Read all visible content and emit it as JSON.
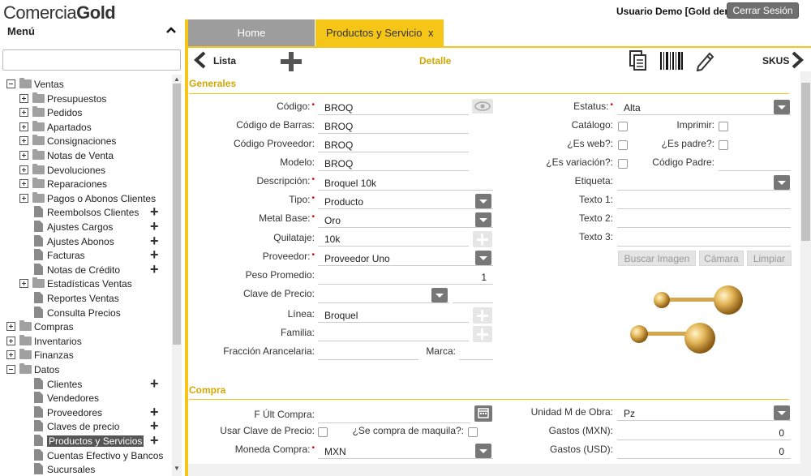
{
  "header": {
    "logo_text_1": "Comercia",
    "logo_text_2": "Gold",
    "user": "Usuario Demo [Gold demo]",
    "logout_label": "Cerrar Sesión"
  },
  "sidebar": {
    "title": "Menú",
    "search_placeholder": "",
    "items": [
      {
        "label": "Ventas",
        "level": 0,
        "kind": "folder-open"
      },
      {
        "label": "Presupuestos",
        "level": 1,
        "kind": "folder"
      },
      {
        "label": "Pedidos",
        "level": 1,
        "kind": "folder"
      },
      {
        "label": "Apartados",
        "level": 1,
        "kind": "folder"
      },
      {
        "label": "Consignaciones",
        "level": 1,
        "kind": "folder"
      },
      {
        "label": "Notas de Venta",
        "level": 1,
        "kind": "folder"
      },
      {
        "label": "Devoluciones",
        "level": 1,
        "kind": "folder"
      },
      {
        "label": "Reparaciones",
        "level": 1,
        "kind": "folder"
      },
      {
        "label": "Pagos o Abonos Clientes",
        "level": 1,
        "kind": "folder"
      },
      {
        "label": "Reembolsos Clientes",
        "level": 1,
        "kind": "doc",
        "add": true
      },
      {
        "label": "Ajustes Cargos",
        "level": 1,
        "kind": "doc",
        "add": true
      },
      {
        "label": "Ajustes Abonos",
        "level": 1,
        "kind": "doc",
        "add": true
      },
      {
        "label": "Facturas",
        "level": 1,
        "kind": "doc",
        "add": true
      },
      {
        "label": "Notas de Crédito",
        "level": 1,
        "kind": "doc",
        "add": true
      },
      {
        "label": "Estadísticas Ventas",
        "level": 1,
        "kind": "folder"
      },
      {
        "label": "Reportes Ventas",
        "level": 1,
        "kind": "doc"
      },
      {
        "label": "Consulta Precios",
        "level": 1,
        "kind": "doc"
      },
      {
        "label": "Compras",
        "level": 0,
        "kind": "folder"
      },
      {
        "label": "Inventarios",
        "level": 0,
        "kind": "folder"
      },
      {
        "label": "Finanzas",
        "level": 0,
        "kind": "folder"
      },
      {
        "label": "Datos",
        "level": 0,
        "kind": "folder-open"
      },
      {
        "label": "Clientes",
        "level": 1,
        "kind": "doc",
        "add": true
      },
      {
        "label": "Vendedores",
        "level": 1,
        "kind": "doc"
      },
      {
        "label": "Proveedores",
        "level": 1,
        "kind": "doc",
        "add": true
      },
      {
        "label": "Claves de precio",
        "level": 1,
        "kind": "doc",
        "add": true
      },
      {
        "label": "Productos y Servicios",
        "level": 1,
        "kind": "doc",
        "add": true,
        "selected": true
      },
      {
        "label": "Cuentas Efectivo y Bancos",
        "level": 1,
        "kind": "doc"
      },
      {
        "label": "Sucursales",
        "level": 1,
        "kind": "doc"
      }
    ]
  },
  "tabs": [
    {
      "label": "Home",
      "active": false
    },
    {
      "label": "Productos y Servicio",
      "active": true,
      "close": "x"
    }
  ],
  "toolbar": {
    "lista": "Lista",
    "detalle": "Detalle",
    "skus": "SKUS"
  },
  "generales": {
    "section": "Generales",
    "codigo": {
      "label": "Código:",
      "value": "BROQ"
    },
    "codigo_barras": {
      "label": "Código de Barras:",
      "value": "BROQ"
    },
    "codigo_proveedor": {
      "label": "Código Proveedor:",
      "value": "BROQ"
    },
    "modelo": {
      "label": "Modelo:",
      "value": "BROQ"
    },
    "descripcion": {
      "label": "Descripción:",
      "value": "Broquel 10k"
    },
    "tipo": {
      "label": "Tipo:",
      "value": "Producto"
    },
    "metal_base": {
      "label": "Metal Base:",
      "value": "Oro"
    },
    "quilataje": {
      "label": "Quilataje:",
      "value": "10k"
    },
    "proveedor": {
      "label": "Proveedor:",
      "value": "Proveedor Uno"
    },
    "peso_promedio": {
      "label": "Peso Promedio:",
      "value": "1"
    },
    "clave_precio": {
      "label": "Clave de Precio:",
      "value": ""
    },
    "linea": {
      "label": "Línea:",
      "value": "Broquel"
    },
    "familia": {
      "label": "Familia:",
      "value": ""
    },
    "fraccion": {
      "label": "Fracción Arancelaria:",
      "value": ""
    },
    "marca": {
      "label": "Marca:",
      "value": ""
    },
    "estatus": {
      "label": "Estatus:",
      "value": "Alta"
    },
    "catalogo": {
      "label": "Catálogo:"
    },
    "imprimir": {
      "label": "Imprimir:"
    },
    "es_web": {
      "label": "¿Es web?:"
    },
    "es_padre": {
      "label": "¿Es padre?:"
    },
    "es_variacion": {
      "label": "¿Es variación?:"
    },
    "codigo_padre": {
      "label": "Código Padre:",
      "value": ""
    },
    "etiqueta": {
      "label": "Etiqueta:",
      "value": ""
    },
    "texto1": {
      "label": "Texto 1:",
      "value": ""
    },
    "texto2": {
      "label": "Texto 2:",
      "value": ""
    },
    "texto3": {
      "label": "Texto 3:",
      "value": ""
    },
    "buscar_imagen": "Buscar Imagen",
    "camara": "Cámara",
    "limpiar": "Limpiar"
  },
  "compra": {
    "section": "Compra",
    "f_ult_compra": {
      "label": "F Últ Compra:",
      "value": ""
    },
    "usar_clave": {
      "label": "Usar Clave de Precio:"
    },
    "se_compra_maquila": {
      "label": "¿Se compra de maquila?:"
    },
    "moneda": {
      "label": "Moneda Compra:",
      "value": "MXN"
    },
    "unidad_obra": {
      "label": "Unidad M de Obra:",
      "value": "Pz"
    },
    "gastos_mxn": {
      "label": "Gastos (MXN):",
      "value": "0"
    },
    "gastos_usd": {
      "label": "Gastos (USD):",
      "value": "0"
    }
  },
  "colors": {
    "accent": "#f5c518",
    "accent_text": "#d4a800",
    "tab_inactive": "#9d9d9d"
  },
  "icons": [
    "chevron-up-icon",
    "arrow-left-icon",
    "plus-icon",
    "copy-icon",
    "barcode-icon",
    "pencil-icon",
    "arrow-right-icon",
    "eye-icon",
    "calendar-icon",
    "product-image"
  ]
}
